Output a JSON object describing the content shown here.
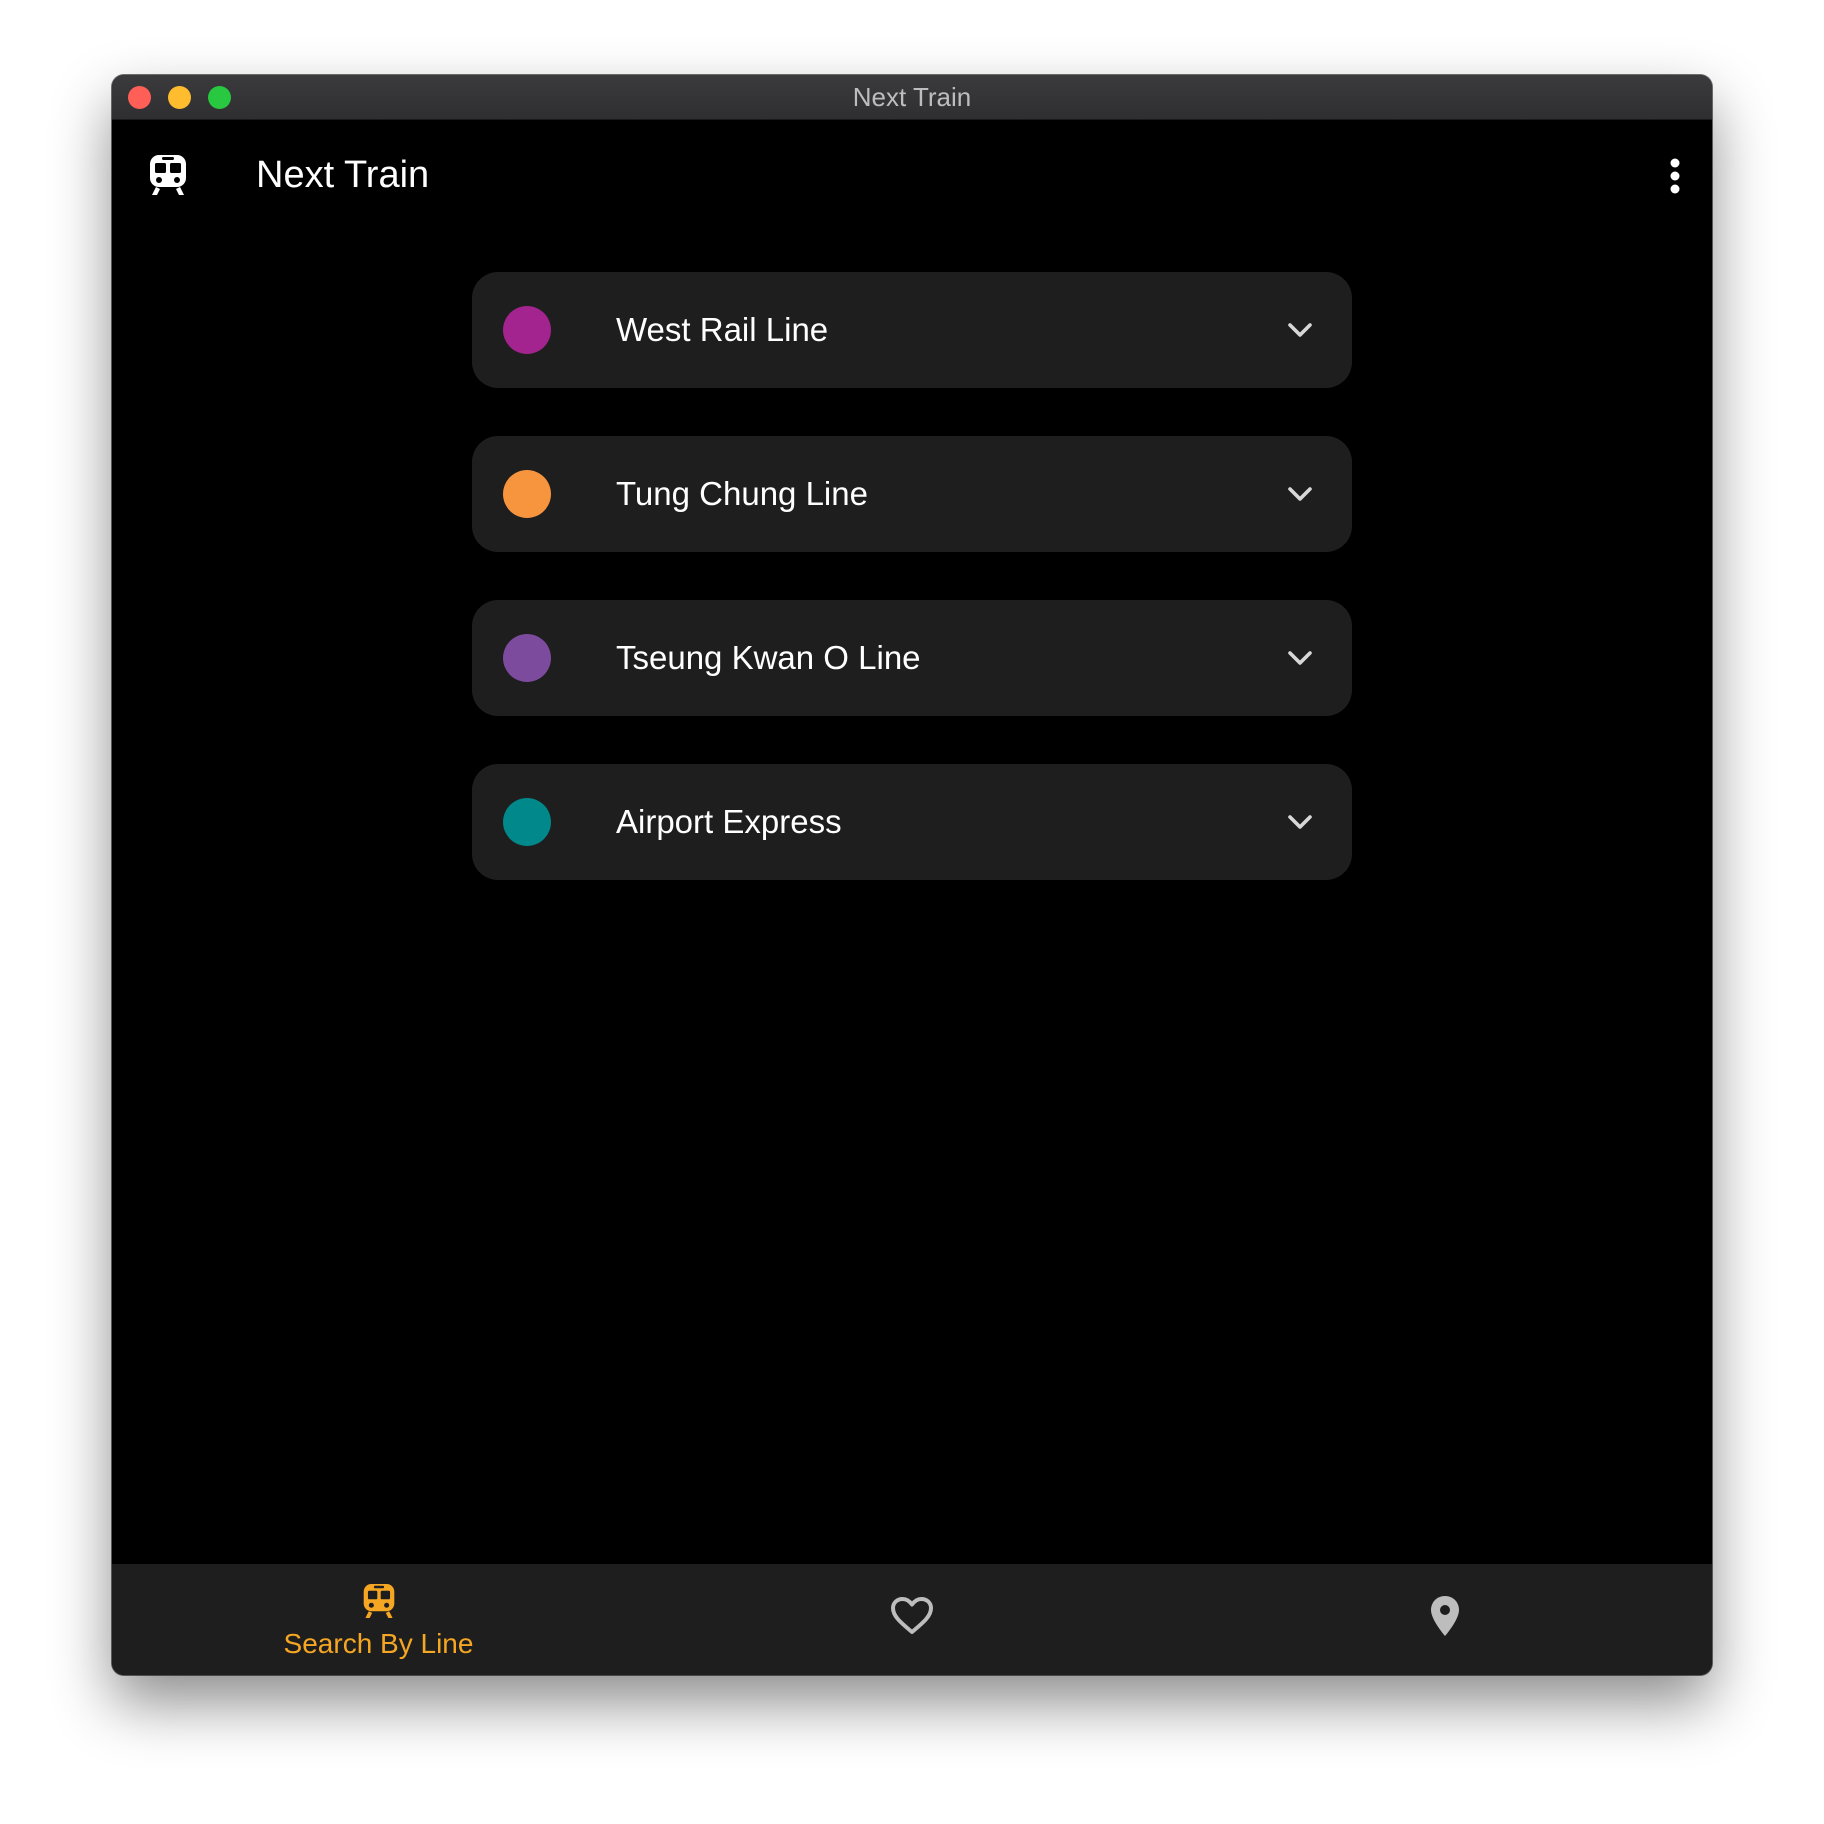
{
  "window": {
    "title": "Next Train",
    "traffic_lights": {
      "close_color": "#ff5f57",
      "minimize_color": "#febc2e",
      "zoom_color": "#28c840"
    }
  },
  "appbar": {
    "logo_icon": "train-icon",
    "title": "Next Train",
    "menu_icon": "more-vert-icon"
  },
  "lines": [
    {
      "name": "West Rail Line",
      "color": "#a3248f",
      "icon": "chevron-down-icon"
    },
    {
      "name": "Tung Chung Line",
      "color": "#f7943e",
      "icon": "chevron-down-icon"
    },
    {
      "name": "Tseung Kwan O Line",
      "color": "#7d4b9d",
      "icon": "chevron-down-icon"
    },
    {
      "name": "Airport Express",
      "color": "#00888a",
      "icon": "chevron-down-icon"
    }
  ],
  "bottom_nav": {
    "active_color": "#f5a623",
    "inactive_color": "#bdbdbd",
    "items": [
      {
        "icon": "train-icon",
        "label": "Search By Line",
        "active": true
      },
      {
        "icon": "heart-outline-icon",
        "label": "",
        "active": false
      },
      {
        "icon": "location-pin-icon",
        "label": "",
        "active": false
      }
    ]
  }
}
